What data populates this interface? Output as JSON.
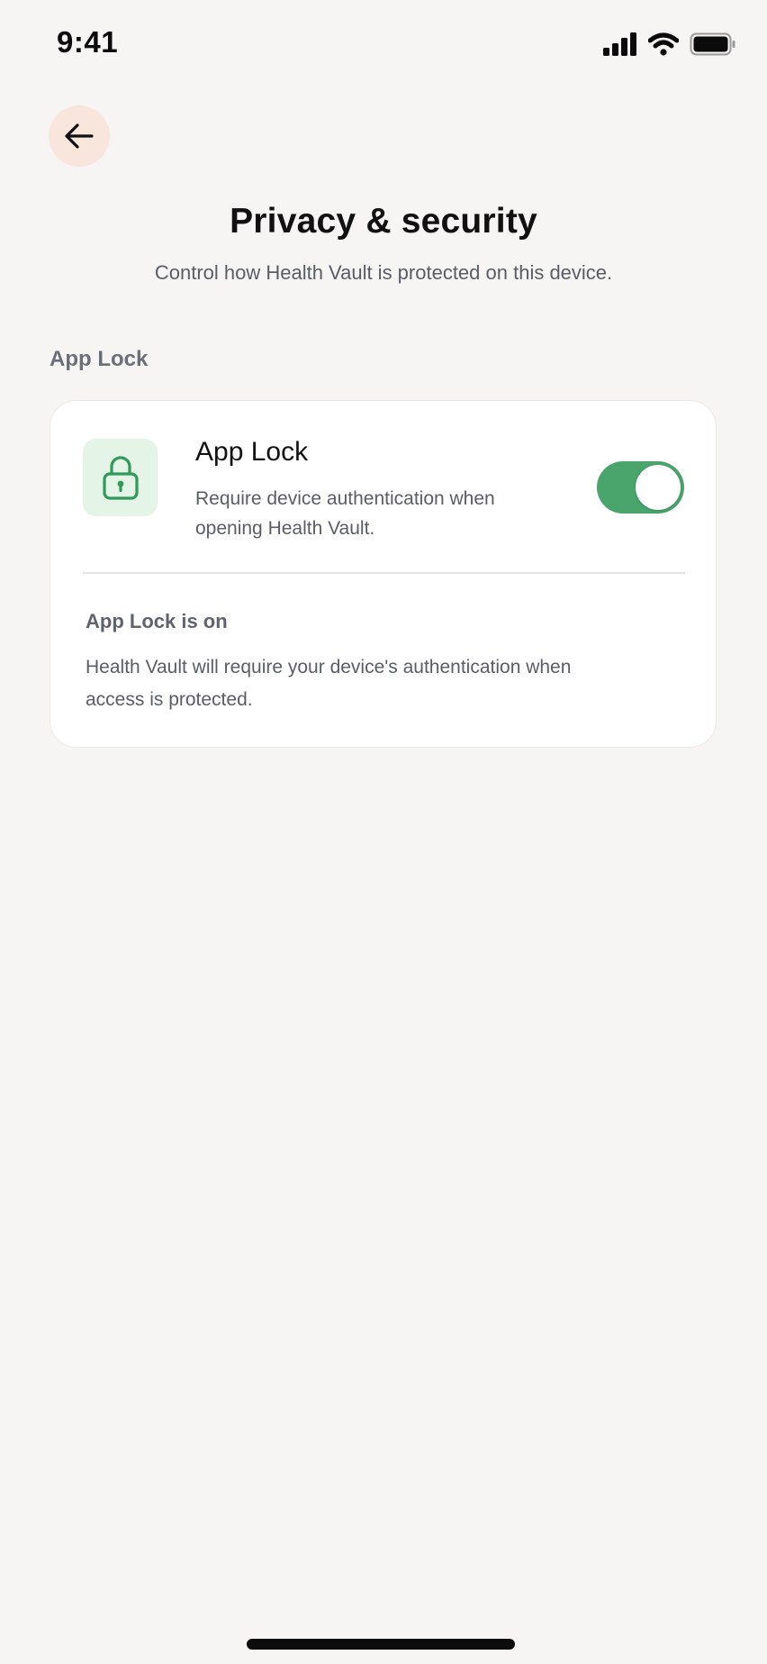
{
  "status_bar": {
    "time": "9:41",
    "icons": [
      "cellular-signal-icon",
      "wifi-icon",
      "battery-icon"
    ]
  },
  "header": {
    "back_icon": "arrow-left-icon",
    "title": "Privacy & security",
    "subtitle": "Control how Health Vault is protected on this device."
  },
  "section": {
    "label": "App Lock"
  },
  "card": {
    "icon": "lock-icon",
    "setting_title": "App Lock",
    "setting_description": "Require device authentication when opening Health Vault.",
    "toggle_on": true,
    "status_heading": "App Lock is on",
    "status_body": "Health Vault will require your device's authentication when access is protected."
  },
  "colors": {
    "background": "#f6f5f4",
    "accent_green": "#4aa56d",
    "lock_tile_bg": "#e4f5e8",
    "back_button_bg": "#f8e5dc"
  }
}
